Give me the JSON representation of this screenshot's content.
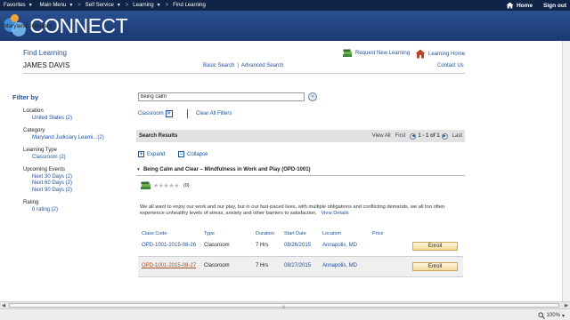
{
  "topbar": {
    "favorites": "Favorites",
    "main_menu": "Main Menu",
    "self_service": "Self Service",
    "learning": "Learning",
    "find_learning": "Find Learning",
    "sep": ">",
    "home": "Home",
    "sign_out": "Sign out"
  },
  "header": {
    "logo_text": "CONNECT",
    "logo_sub": "Maryland Judiciary"
  },
  "page": {
    "title": "Find Learning",
    "user": "JAMES DAVIS",
    "basic_search": "Basic Search",
    "link_sep": "|",
    "advanced_search": "Advanced Search",
    "request_new": "Request New Learning",
    "learning_home": "Learning Home",
    "contact_us": "Contact Us"
  },
  "filters": {
    "title": "Filter by",
    "groups": [
      {
        "heading": "Location",
        "values": [
          "United States (2)"
        ]
      },
      {
        "heading": "Category",
        "values": [
          "Maryland Judiciary Learni...(2)"
        ]
      },
      {
        "heading": "Learning Type",
        "values": [
          "Classroom (2)"
        ]
      },
      {
        "heading": "Upcoming Events",
        "values": [
          "Next 30 Days (2)",
          "Next 60 Days (2)",
          "Next 90 Days (2)"
        ]
      },
      {
        "heading": "Rating",
        "values": [
          "0 rating (2)"
        ]
      }
    ]
  },
  "search": {
    "value": "being calm",
    "go_glyph": "»"
  },
  "active_filter": {
    "label": "Classroom",
    "remove_glyph": "✕",
    "clear_all": "Clear All Filters"
  },
  "results": {
    "title": "Search Results",
    "view_all": "View All",
    "first": "First",
    "prev_glyph": "◀",
    "range": "1 - 1 of 1",
    "next_glyph": "▶",
    "last": "Last",
    "expand": "Expand",
    "collapse": "Collapse",
    "expand_glyph": "+",
    "collapse_glyph": "−"
  },
  "course": {
    "title": "Being Calm and Clear – Mindfulness in Work and Play (OPD-1001)",
    "stars": "★★★★★",
    "rating_count": "(0)",
    "rating_value": 0,
    "description": "We all want to enjoy our work and our play, but in our fast-paced lives, with multiple obligations and conflicting demands, we all too often experience unhealthy levels of stress, anxiety and other barriers to satisfaction.",
    "view_details": "View Details",
    "columns": [
      "Class Code",
      "Type",
      "Duration",
      "Start Date",
      "Location",
      "Price"
    ],
    "classes": [
      {
        "code": "OPD-1001-2015-08-26",
        "type": "Classroom",
        "duration": "7 Hrs",
        "start": "08/26/2015",
        "location": "Annapolis, MD",
        "price": "",
        "enroll": "Enroll"
      },
      {
        "code": "OPD-1001-2015-08-27",
        "type": "Classroom",
        "duration": "7 Hrs",
        "start": "08/27/2015",
        "location": "Annapolis, MD",
        "price": "",
        "enroll": "Enroll"
      }
    ]
  },
  "statusbar": {
    "zoom": "100%",
    "zoom_caret": "▾"
  },
  "colors": {
    "topbar": "#0f2446",
    "header": "#1a3a72",
    "link": "#1c4f9c",
    "enroll": "#f2d89a"
  }
}
